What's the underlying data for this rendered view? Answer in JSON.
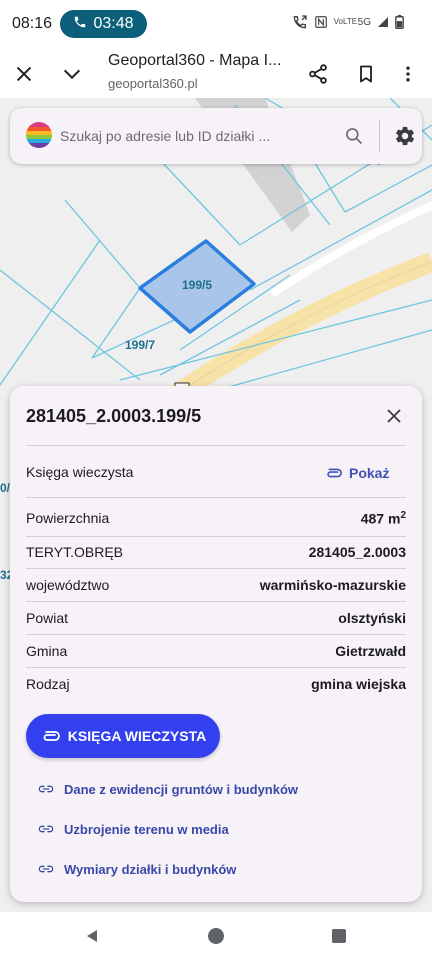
{
  "status_bar": {
    "time": "08:16",
    "call_timer": "03:48",
    "network": "5G",
    "volte": "VoLTE"
  },
  "browser": {
    "title": "Geoportal360 - Mapa I...",
    "url": "geoportal360.pl",
    "icons": [
      "close-icon",
      "chevron-down-icon",
      "share-icon",
      "bookmark-icon",
      "more-vert-icon"
    ]
  },
  "map": {
    "selected_parcel_label": "199/5",
    "neighbor_parcel_label": "199/7",
    "edge_labels": [
      "0/",
      "32"
    ],
    "colors": {
      "background": "#efefef",
      "parcel_lines": "#6ec6e0",
      "selected_fill": "#a9c6ea",
      "selected_stroke": "#2a7ee0",
      "road": "#f7e2a8",
      "building": "#cfcfcf"
    }
  },
  "search": {
    "placeholder": "Szukaj po adresie lub ID działki ..."
  },
  "panel": {
    "title": "281405_2.0003.199/5",
    "land_registry_label": "Księga wieczysta",
    "show_link": "Pokaż",
    "rows": [
      {
        "label": "Powierzchnia",
        "value": "487 m",
        "sup": "2"
      },
      {
        "label": "TERYT.OBRĘB",
        "value": "281405_2.0003"
      },
      {
        "label": "województwo",
        "value": "warmińsko-mazurskie"
      },
      {
        "label": "Powiat",
        "value": "olsztyński"
      },
      {
        "label": "Gmina",
        "value": "Gietrzwałd"
      },
      {
        "label": "Rodzaj",
        "value": "gmina wiejska"
      }
    ],
    "primary_button": "KSIĘGA WIECZYSTA",
    "links": [
      "Dane z ewidencji gruntów i budynków",
      "Uzbrojenie terenu w media",
      "Wymiary działki i budynków"
    ],
    "accent_color": "#3340f0"
  }
}
